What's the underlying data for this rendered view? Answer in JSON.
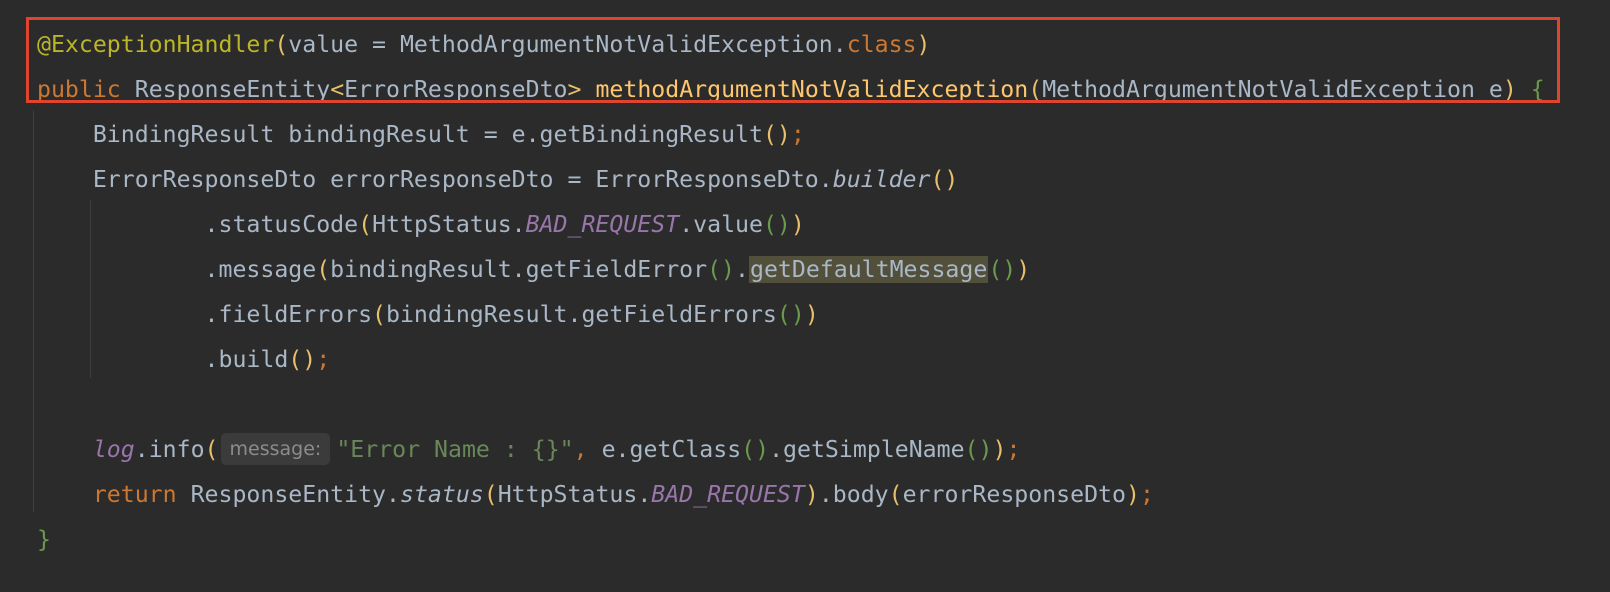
{
  "editor": {
    "lines": [
      {
        "segments": [
          {
            "text": "@ExceptionHandler",
            "cls": "ann"
          },
          {
            "text": "(",
            "cls": "br-y"
          },
          {
            "text": "value = MethodArgumentNotValidException.",
            "cls": ""
          },
          {
            "text": "class",
            "cls": "kw"
          },
          {
            "text": ")",
            "cls": "br-y"
          }
        ]
      },
      {
        "segments": [
          {
            "text": "public ",
            "cls": "kw"
          },
          {
            "text": "ResponseEntity",
            "cls": ""
          },
          {
            "text": "<",
            "cls": "br-y"
          },
          {
            "text": "ErrorResponseDto",
            "cls": ""
          },
          {
            "text": "> ",
            "cls": "br-y"
          },
          {
            "text": "methodArgumentNotValidException",
            "cls": "fn"
          },
          {
            "text": "(",
            "cls": "br-y"
          },
          {
            "text": "MethodArgumentNotValidException e",
            "cls": ""
          },
          {
            "text": ")",
            "cls": "br-y"
          },
          {
            "text": " {",
            "cls": "br-g"
          }
        ]
      },
      {
        "segments": [
          {
            "text": "    BindingResult bindingResult = e.getBindingResult",
            "cls": ""
          },
          {
            "text": "()",
            "cls": "br-y"
          },
          {
            "text": ";",
            "cls": "semi"
          }
        ]
      },
      {
        "segments": [
          {
            "text": "    ErrorResponseDto errorResponseDto = ErrorResponseDto.",
            "cls": ""
          },
          {
            "text": "builder",
            "cls": "static-method"
          },
          {
            "text": "()",
            "cls": "br-y"
          }
        ]
      },
      {
        "segments": [
          {
            "text": "            .statusCode",
            "cls": ""
          },
          {
            "text": "(",
            "cls": "br-y"
          },
          {
            "text": "HttpStatus.",
            "cls": ""
          },
          {
            "text": "BAD_REQUEST",
            "cls": "static-field"
          },
          {
            "text": ".value",
            "cls": ""
          },
          {
            "text": "()",
            "cls": "br-g"
          },
          {
            "text": ")",
            "cls": "br-y"
          }
        ]
      },
      {
        "segments": [
          {
            "text": "            .message",
            "cls": ""
          },
          {
            "text": "(",
            "cls": "br-y"
          },
          {
            "text": "bindingResult.getFieldError",
            "cls": ""
          },
          {
            "text": "()",
            "cls": "br-g"
          },
          {
            "text": ".",
            "cls": ""
          },
          {
            "text": "getDefaultMessage",
            "cls": "hl"
          },
          {
            "text": "()",
            "cls": "br-g"
          },
          {
            "text": ")",
            "cls": "br-y"
          }
        ]
      },
      {
        "segments": [
          {
            "text": "            .fieldErrors",
            "cls": ""
          },
          {
            "text": "(",
            "cls": "br-y"
          },
          {
            "text": "bindingResult.getFieldErrors",
            "cls": ""
          },
          {
            "text": "()",
            "cls": "br-g"
          },
          {
            "text": ")",
            "cls": "br-y"
          }
        ]
      },
      {
        "segments": [
          {
            "text": "            .build",
            "cls": ""
          },
          {
            "text": "()",
            "cls": "br-y"
          },
          {
            "text": ";",
            "cls": "semi"
          }
        ]
      },
      {
        "segments": []
      },
      {
        "segments": [
          {
            "text": "    ",
            "cls": ""
          },
          {
            "text": "log",
            "cls": "static-field-plain"
          },
          {
            "text": ".info",
            "cls": ""
          },
          {
            "text": "(",
            "cls": "br-y"
          },
          {
            "text": "message:",
            "cls": "hint"
          },
          {
            "text": "\"Error Name : {}\"",
            "cls": "str"
          },
          {
            "text": ", ",
            "cls": "semi"
          },
          {
            "text": "e.getClass",
            "cls": ""
          },
          {
            "text": "()",
            "cls": "br-g"
          },
          {
            "text": ".getSimpleName",
            "cls": ""
          },
          {
            "text": "()",
            "cls": "br-g"
          },
          {
            "text": ")",
            "cls": "br-y"
          },
          {
            "text": ";",
            "cls": "semi"
          }
        ]
      },
      {
        "segments": [
          {
            "text": "    ",
            "cls": ""
          },
          {
            "text": "return ",
            "cls": "kw"
          },
          {
            "text": "ResponseEntity.",
            "cls": ""
          },
          {
            "text": "status",
            "cls": "static-method"
          },
          {
            "text": "(",
            "cls": "br-y"
          },
          {
            "text": "HttpStatus.",
            "cls": ""
          },
          {
            "text": "BAD_REQUEST",
            "cls": "static-field"
          },
          {
            "text": ")",
            "cls": "br-y"
          },
          {
            "text": ".body",
            "cls": ""
          },
          {
            "text": "(",
            "cls": "br-y"
          },
          {
            "text": "errorResponseDto",
            "cls": ""
          },
          {
            "text": ")",
            "cls": "br-y"
          },
          {
            "text": ";",
            "cls": "semi"
          }
        ]
      },
      {
        "segments": [
          {
            "text": "}",
            "cls": "br-g"
          }
        ]
      }
    ]
  },
  "theme": {
    "background": "#2b2b2b",
    "default_text": "#a9b7c6",
    "keyword": "#cc7832",
    "annotation": "#bbb529",
    "method_declaration": "#ffc66d",
    "static_field": "#9876aa",
    "string": "#6a8759",
    "bracket_outer": "#e8bf6a",
    "bracket_inner": "#6a9a4d",
    "selection_box": "#e0432e"
  }
}
